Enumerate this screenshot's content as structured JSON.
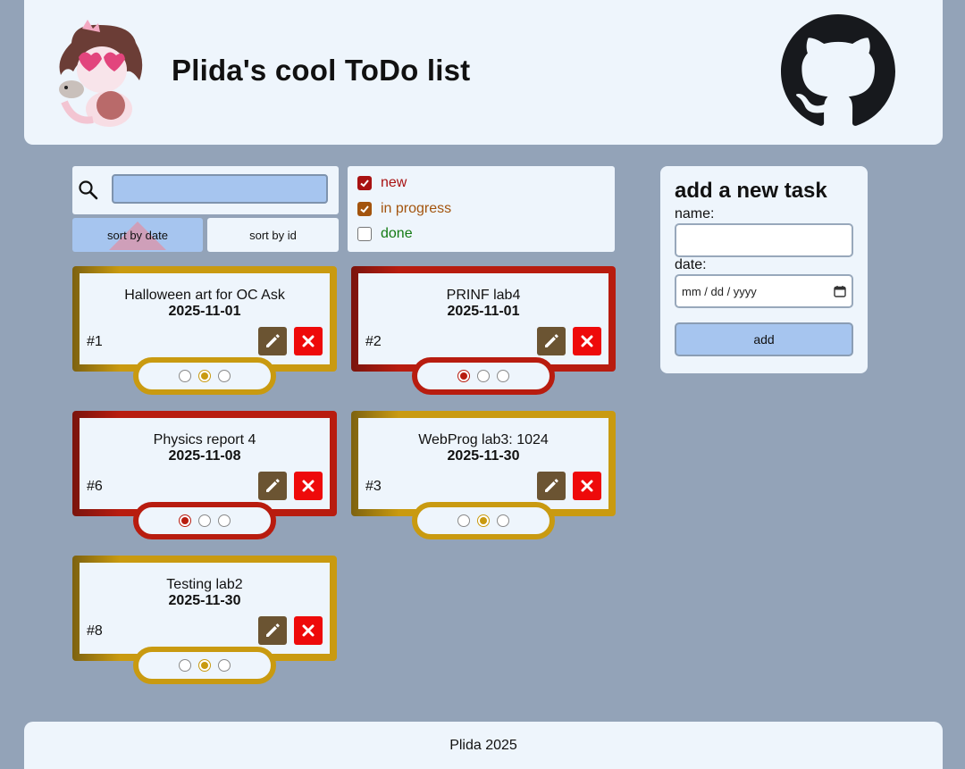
{
  "header": {
    "title": "Plida's cool ToDo list",
    "github_icon": "github-icon"
  },
  "toolbar": {
    "sort_date_label": "sort by date",
    "sort_id_label": "sort by id",
    "search_value": ""
  },
  "filters": [
    {
      "label": "new",
      "checked": true,
      "color": "#a81212"
    },
    {
      "label": "in progress",
      "checked": true,
      "color": "#a3540e"
    },
    {
      "label": "done",
      "checked": false,
      "color": "#137a12"
    }
  ],
  "colors": {
    "new": "#b81c0f",
    "in_progress": "#c99a10",
    "background": "#93a3b8",
    "panel": "#eef5fc"
  },
  "tasks": [
    {
      "name": "Halloween art for OC Ask",
      "date": "2025-11-01",
      "id": "#1",
      "status": "in progress"
    },
    {
      "name": "PRINF lab4",
      "date": "2025-11-01",
      "id": "#2",
      "status": "new"
    },
    {
      "name": "Physics report 4",
      "date": "2025-11-08",
      "id": "#6",
      "status": "new"
    },
    {
      "name": "WebProg lab3: 1024",
      "date": "2025-11-30",
      "id": "#3",
      "status": "in progress"
    },
    {
      "name": "Testing lab2",
      "date": "2025-11-30",
      "id": "#8",
      "status": "in progress"
    }
  ],
  "add_form": {
    "title": "add a new task",
    "name_label": "name:",
    "name_value": "",
    "date_label": "date:",
    "date_placeholder": "mm / dd / yyyy",
    "button_label": "add"
  },
  "footer": {
    "text": "Plida 2025"
  }
}
